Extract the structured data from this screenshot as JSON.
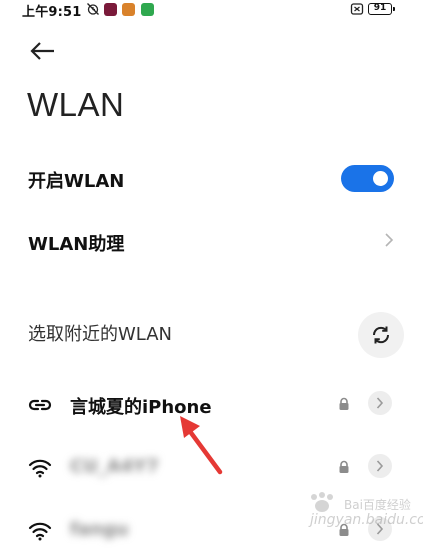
{
  "status_bar": {
    "time": "上午9:51",
    "battery": "91",
    "icons": [
      "alarm-off-icon",
      "app-badge-red-icon",
      "app-badge-orange-icon",
      "app-badge-green-icon",
      "sim-off-icon"
    ]
  },
  "header": {
    "title": "WLAN"
  },
  "settings": {
    "enable_wlan_label": "开启WLAN",
    "enable_wlan_on": true,
    "assistant_label": "WLAN助理"
  },
  "nearby": {
    "section_label": "选取附近的WLAN",
    "networks": [
      {
        "name": "言城夏的iPhone",
        "icon": "hotspot-link-icon",
        "locked": true
      },
      {
        "name": "CU_A4Y7",
        "icon": "wifi-icon",
        "locked": true
      },
      {
        "name": "fangu",
        "icon": "wifi-icon",
        "locked": true
      }
    ]
  },
  "colors": {
    "toggle_on": "#1a73e8",
    "annotation_arrow": "#e53935"
  },
  "watermark": {
    "text": "Bai百度经验",
    "sub": "jingyan.baidu.com"
  }
}
